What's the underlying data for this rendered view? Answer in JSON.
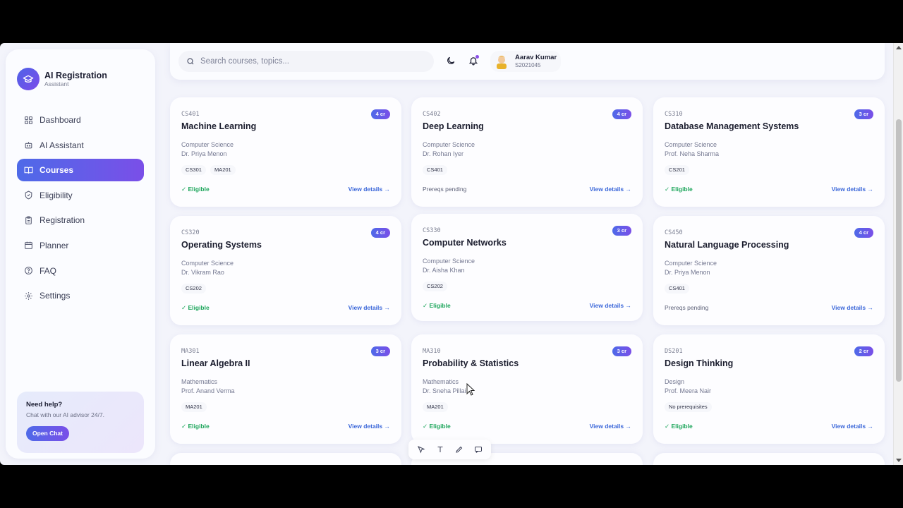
{
  "brand": {
    "title": "AI Registration",
    "subtitle": "Assistant"
  },
  "nav": [
    {
      "label": "Dashboard",
      "icon": "grid-icon",
      "active": false
    },
    {
      "label": "AI Assistant",
      "icon": "robot-icon",
      "active": false
    },
    {
      "label": "Courses",
      "icon": "book-icon",
      "active": true
    },
    {
      "label": "Eligibility",
      "icon": "shield-check-icon",
      "active": false
    },
    {
      "label": "Registration",
      "icon": "clipboard-icon",
      "active": false
    },
    {
      "label": "Planner",
      "icon": "calendar-icon",
      "active": false
    },
    {
      "label": "FAQ",
      "icon": "help-circle-icon",
      "active": false
    },
    {
      "label": "Settings",
      "icon": "gear-icon",
      "active": false
    }
  ],
  "help": {
    "title": "Need help?",
    "subtitle": "Chat with our AI advisor 24/7.",
    "button": "Open Chat"
  },
  "search": {
    "placeholder": "Search courses, topics..."
  },
  "user": {
    "name": "Aarav Kumar",
    "id": "S2021045"
  },
  "courses": [
    {
      "code": "CS401",
      "credits": "4 cr",
      "title": "Machine Learning",
      "dept": "Computer Science",
      "prof": "Dr. Priya Menon",
      "prereqs": [
        "CS301",
        "MA201"
      ],
      "status": "✓ Eligible",
      "eligible": true,
      "details": "View details →"
    },
    {
      "code": "CS402",
      "credits": "4 cr",
      "title": "Deep Learning",
      "dept": "Computer Science",
      "prof": "Dr. Rohan Iyer",
      "prereqs": [
        "CS401"
      ],
      "status": "Prereqs pending",
      "eligible": false,
      "details": "View details →"
    },
    {
      "code": "CS310",
      "credits": "3 cr",
      "title": "Database Management Systems",
      "dept": "Computer Science",
      "prof": "Prof. Neha Sharma",
      "prereqs": [
        "CS201"
      ],
      "status": "✓ Eligible",
      "eligible": true,
      "details": "View details →"
    },
    {
      "code": "CS320",
      "credits": "4 cr",
      "title": "Operating Systems",
      "dept": "Computer Science",
      "prof": "Dr. Vikram Rao",
      "prereqs": [
        "CS202"
      ],
      "status": "✓ Eligible",
      "eligible": true,
      "details": "View details →"
    },
    {
      "code": "CS330",
      "credits": "3 cr",
      "title": "Computer Networks",
      "dept": "Computer Science",
      "prof": "Dr. Aisha Khan",
      "prereqs": [
        "CS202"
      ],
      "status": "✓ Eligible",
      "eligible": true,
      "details": "View details →"
    },
    {
      "code": "CS450",
      "credits": "4 cr",
      "title": "Natural Language Processing",
      "dept": "Computer Science",
      "prof": "Dr. Priya Menon",
      "prereqs": [
        "CS401"
      ],
      "status": "Prereqs pending",
      "eligible": false,
      "details": "View details →"
    },
    {
      "code": "MA301",
      "credits": "3 cr",
      "title": "Linear Algebra II",
      "dept": "Mathematics",
      "prof": "Prof. Anand Verma",
      "prereqs": [
        "MA201"
      ],
      "status": "✓ Eligible",
      "eligible": true,
      "details": "View details →"
    },
    {
      "code": "MA310",
      "credits": "3 cr",
      "title": "Probability & Statistics",
      "dept": "Mathematics",
      "prof": "Dr. Sneha Pillai",
      "prereqs": [
        "MA201"
      ],
      "status": "✓ Eligible",
      "eligible": true,
      "details": "View details →"
    },
    {
      "code": "DS201",
      "credits": "2 cr",
      "title": "Design Thinking",
      "dept": "Design",
      "prof": "Prof. Meera Nair",
      "prereqs": [
        "No prerequisites"
      ],
      "status": "✓ Eligible",
      "eligible": true,
      "details": "View details →"
    }
  ],
  "toolbar": {
    "icons": [
      "select-icon",
      "text-icon",
      "pen-icon",
      "comment-icon"
    ]
  }
}
